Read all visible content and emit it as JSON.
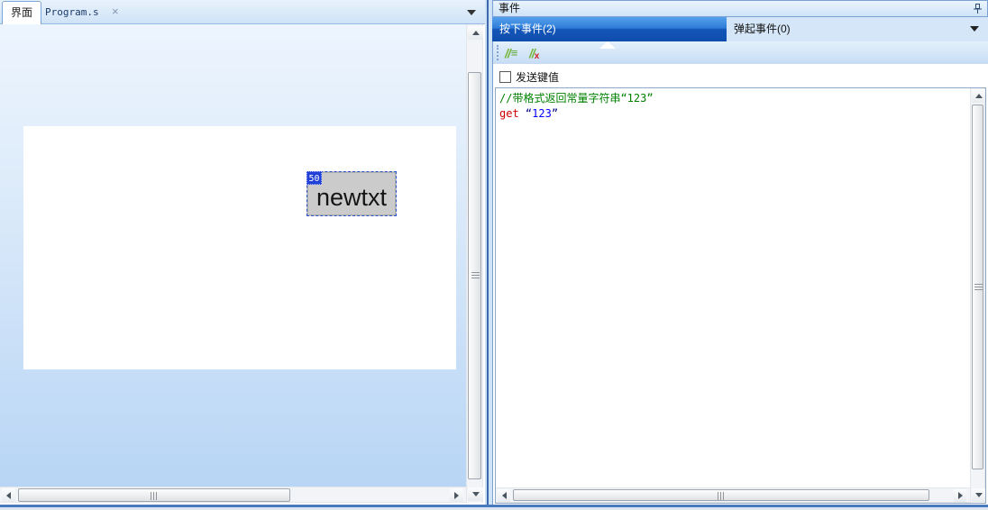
{
  "left_panel": {
    "tabs": [
      {
        "label": "界面"
      },
      {
        "label": "Program.s"
      }
    ],
    "close_icon": "×",
    "designer": {
      "control_label": "newtxt",
      "control_id_badge": "50"
    }
  },
  "right_panel": {
    "title": "事件",
    "tabs": [
      {
        "label": "按下事件(2)",
        "active": true
      },
      {
        "label": "弹起事件(0)",
        "active": false
      }
    ],
    "toolbar": {
      "comment_button": {
        "slashes": "//",
        "lines": "≡"
      },
      "uncomment_button": {
        "slashes": "//",
        "x": "x"
      }
    },
    "send_key_checkbox": {
      "label": "发送键值",
      "checked": false
    },
    "code": {
      "comment_line": "//带格式返回常量字符串“123”",
      "keyword": "get",
      "quote_open": "“",
      "string_value": "123",
      "quote_close": "”"
    }
  },
  "colors": {
    "active_tab_blue": "#1254b4",
    "panel_divider_blue": "#3e68ae",
    "comment_green": "#008000",
    "keyword_red": "#cc0000",
    "string_blue": "#0000ff",
    "quote_navy": "#000080",
    "selection_dash_blue": "#2f55cc",
    "badge_blue": "#2040d8"
  }
}
